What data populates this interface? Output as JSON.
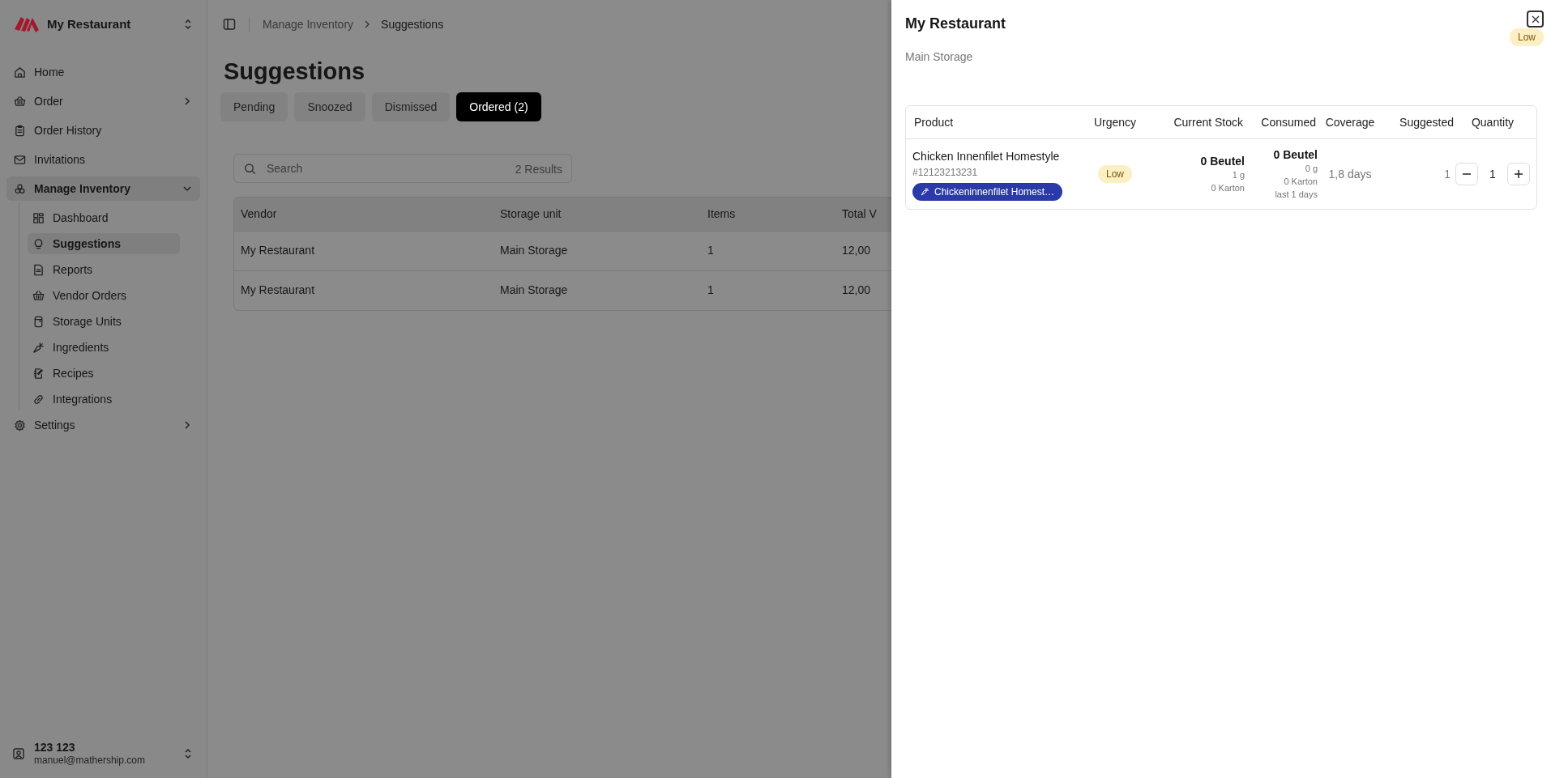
{
  "sidebar": {
    "brand": "My Restaurant",
    "items": [
      {
        "label": "Home",
        "selected": false
      },
      {
        "label": "Order",
        "selected": false,
        "expanded": false
      },
      {
        "label": "Order History",
        "selected": false
      },
      {
        "label": "Invitations",
        "selected": false
      },
      {
        "label": "Manage Inventory",
        "selected": true,
        "expanded": true,
        "children": [
          {
            "label": "Dashboard",
            "selected": false
          },
          {
            "label": "Suggestions",
            "selected": true
          },
          {
            "label": "Reports",
            "selected": false
          },
          {
            "label": "Vendor Orders",
            "selected": false
          },
          {
            "label": "Storage Units",
            "selected": false
          },
          {
            "label": "Ingredients",
            "selected": false
          },
          {
            "label": "Recipes",
            "selected": false
          },
          {
            "label": "Integrations",
            "selected": false
          }
        ]
      },
      {
        "label": "Settings",
        "selected": false,
        "expanded": false
      }
    ],
    "user": {
      "name": "123 123",
      "email": "manuel@mathership.com"
    }
  },
  "breadcrumb": [
    "Manage Inventory",
    "Suggestions"
  ],
  "page_title": "Suggestions",
  "tabs": [
    {
      "label": "Pending",
      "selected": false
    },
    {
      "label": "Snoozed",
      "selected": false
    },
    {
      "label": "Dismissed",
      "selected": false
    },
    {
      "label": "Ordered (2)",
      "selected": true
    }
  ],
  "search": {
    "placeholder": "Search",
    "result_count": "2 Results"
  },
  "table": {
    "columns": [
      "Vendor",
      "Storage unit",
      "Items",
      "Total V"
    ],
    "rows": [
      [
        "My Restaurant",
        "Main Storage",
        "1",
        "12,00"
      ],
      [
        "My Restaurant",
        "Main Storage",
        "1",
        "12,00"
      ]
    ]
  },
  "sheet": {
    "title": "My Restaurant",
    "subtitle": "Main Storage",
    "urgency_badge": "Low",
    "columns": [
      "Product",
      "Urgency",
      "Current Stock",
      "Consumed",
      "Coverage",
      "Suggested",
      "Quantity"
    ],
    "rows": [
      {
        "product": "Chicken Innenfilet Homestyle",
        "sku": "#12123213231",
        "ingredient_tag": "Chickeninnenfilet Homest…",
        "urgency": "Low",
        "current_stock": {
          "main": "0 Beutel",
          "details": [
            "1 g",
            "0 Karton"
          ]
        },
        "consumed": {
          "main": "0 Beutel",
          "details": [
            "0 g",
            "0 Karton",
            "last 1 days"
          ]
        },
        "coverage": "1,8 days",
        "suggested": "1",
        "quantity": "1"
      }
    ]
  }
}
